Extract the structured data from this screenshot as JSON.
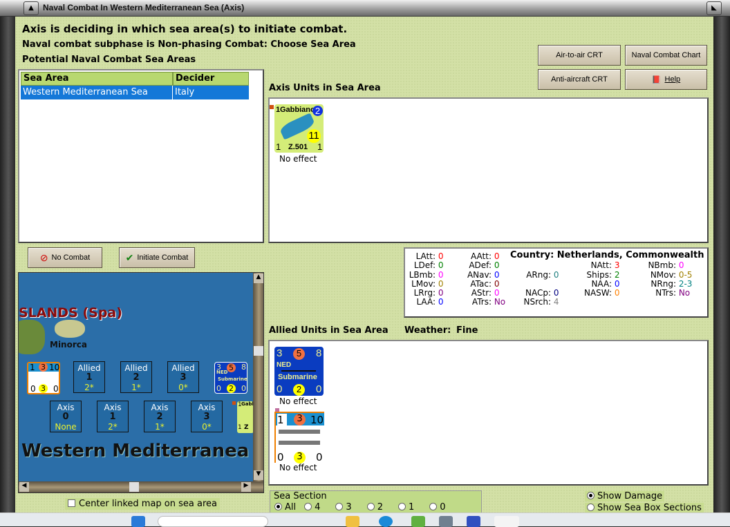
{
  "window": {
    "title": "Naval Combat In Western Mediterranean Sea (Axis)"
  },
  "header": {
    "line1": "Axis is deciding in which sea area(s) to initiate combat.",
    "line2": "Naval combat subphase is Non-phasing Combat: Choose Sea Area",
    "line3": "Potential Naval Combat Sea Areas"
  },
  "buttons": {
    "air_to_air": "Air-to-air CRT",
    "naval_chart": "Naval Combat Chart",
    "anti_aircraft": "Anti-aircraft CRT",
    "help": "Help",
    "no_combat": "No Combat",
    "initiate": "Initiate Combat"
  },
  "table": {
    "columns": [
      "Sea Area",
      "Decider"
    ],
    "rows": [
      {
        "sea_area": "Western Mediterranean Sea",
        "decider": "Italy"
      }
    ]
  },
  "axis_units": {
    "label": "Axis Units in Sea Area",
    "units": [
      {
        "name": "Gabbiano",
        "type": "Z.501",
        "top_left": "1",
        "badge": "2",
        "range": "11",
        "bottom_left": "1",
        "bottom_right": "1",
        "status": "No effect"
      }
    ]
  },
  "stats": {
    "country_label": "Country: Netherlands, Commonwealth",
    "items": [
      {
        "label": "LAtt:",
        "value": "0",
        "color": "#ff0000"
      },
      {
        "label": "LDef:",
        "value": "0",
        "color": "#008000"
      },
      {
        "label": "LBmb:",
        "value": "0",
        "color": "#ff00ff"
      },
      {
        "label": "LMov:",
        "value": "0",
        "color": "#a08000"
      },
      {
        "label": "LRrg:",
        "value": "0",
        "color": "#800080"
      },
      {
        "label": "LAA:",
        "value": "0",
        "color": "#0000ff"
      },
      {
        "label": "AAtt:",
        "value": "0",
        "color": "#ff0000"
      },
      {
        "label": "ADef:",
        "value": "0",
        "color": "#008000"
      },
      {
        "label": "ANav:",
        "value": "0",
        "color": "#0000ff"
      },
      {
        "label": "ATac:",
        "value": "0",
        "color": "#800000"
      },
      {
        "label": "AStr:",
        "value": "0",
        "color": "#ff00ff"
      },
      {
        "label": "ATrs:",
        "value": "No",
        "color": "#800080"
      },
      {
        "label": "ARng:",
        "value": "0",
        "color": "#208080"
      },
      {
        "label": "NACp:",
        "value": "0",
        "color": "#000080"
      },
      {
        "label": "NSrch:",
        "value": "4",
        "color": "#808080"
      },
      {
        "label": "NAtt:",
        "value": "3",
        "color": "#ff0000"
      },
      {
        "label": "Ships:",
        "value": "2",
        "color": "#008000"
      },
      {
        "label": "NAA:",
        "value": "0",
        "color": "#0000ff"
      },
      {
        "label": "NASW:",
        "value": "0",
        "color": "#ff8000"
      },
      {
        "label": "NBmb:",
        "value": "0",
        "color": "#ff00ff"
      },
      {
        "label": "NMov:",
        "value": "0-5",
        "color": "#a08000"
      },
      {
        "label": "NRng:",
        "value": "2-3",
        "color": "#008080"
      },
      {
        "label": "NTrs:",
        "value": "No",
        "color": "#800080"
      }
    ]
  },
  "allied_units": {
    "label": "Allied Units in Sea Area",
    "weather_label": "Weather:",
    "weather": "Fine",
    "units": [
      {
        "nation": "NED",
        "type": "Submarine",
        "tl": "3",
        "mid": "5",
        "tr": "8",
        "bl": "0",
        "bm": "2",
        "br": "0",
        "status": "No effect"
      },
      {
        "tl": "1",
        "mid": "3",
        "tr": "10",
        "bl": "0",
        "bm": "3",
        "br": "0",
        "status": "No effect"
      }
    ]
  },
  "map": {
    "region": "SLANDS (Spa)",
    "island": "Minorca",
    "sea": "Western Mediterranea",
    "allied_boxes": [
      {
        "side": "Allied",
        "num": "1",
        "val": "2*"
      },
      {
        "side": "Allied",
        "num": "2",
        "val": "1*"
      },
      {
        "side": "Allied",
        "num": "3",
        "val": "0*"
      }
    ],
    "axis_boxes": [
      {
        "side": "Axis",
        "num": "0",
        "val": "None"
      },
      {
        "side": "Axis",
        "num": "1",
        "val": "2*"
      },
      {
        "side": "Axis",
        "num": "2",
        "val": "1*"
      },
      {
        "side": "Axis",
        "num": "3",
        "val": "0*"
      }
    ],
    "mini_counters": {
      "ship": {
        "tl": "1",
        "mid": "3",
        "tr": "10",
        "bl": "0",
        "bm": "3",
        "br": "0"
      },
      "sub": {
        "tl": "3",
        "mid": "5",
        "tr": "8",
        "nation": "NED",
        "type": "Submarine",
        "bl": "0",
        "bm": "2",
        "br": "0"
      },
      "plane": {
        "tl": "1",
        "name": "Gabb",
        "bl": "1",
        "type": "Z"
      }
    }
  },
  "center_linked": {
    "label": "Center linked map on sea area",
    "checked": false
  },
  "sea_section": {
    "legend": "Sea Section",
    "options": [
      "All",
      "4",
      "3",
      "2",
      "1",
      "0"
    ],
    "selected": "All"
  },
  "display_options": {
    "show_damage": "Show Damage",
    "show_sections": "Show Sea Box Sections",
    "selected": "Show Damage"
  }
}
